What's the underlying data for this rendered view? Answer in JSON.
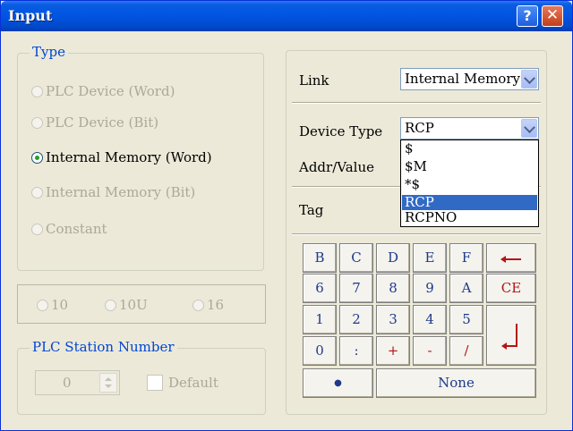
{
  "window": {
    "title": "Input",
    "help_glyph": "?",
    "close_glyph": "✕"
  },
  "type_group": {
    "legend": "Type",
    "options": [
      {
        "label": "PLC Device (Word)",
        "selected": false,
        "enabled": false
      },
      {
        "label": "PLC Device (Bit)",
        "selected": false,
        "enabled": false
      },
      {
        "label": "Internal Memory (Word)",
        "selected": true,
        "enabled": true
      },
      {
        "label": "Internal Memory (Bit)",
        "selected": false,
        "enabled": false
      },
      {
        "label": "Constant",
        "selected": false,
        "enabled": false
      }
    ]
  },
  "radix_group": {
    "options": [
      "10",
      "10U",
      "16"
    ]
  },
  "station_group": {
    "legend": "PLC Station Number",
    "value": "0",
    "default_label": "Default"
  },
  "right": {
    "link_label": "Link",
    "link_value": "Internal Memory",
    "device_type_label": "Device Type",
    "device_type_value": "RCP",
    "addr_label": "Addr/Value",
    "tag_label": "Tag",
    "dropdown_items": [
      "$",
      "$M",
      "*$",
      "RCP",
      "RCPNO"
    ],
    "dropdown_selected": "RCP"
  },
  "keypad": {
    "row1": [
      "B",
      "C",
      "D",
      "E",
      "F"
    ],
    "row2": [
      "6",
      "7",
      "8",
      "9",
      "A"
    ],
    "row3": [
      "1",
      "2",
      "3",
      "4",
      "5"
    ],
    "row4": [
      "0",
      ":",
      "+",
      "-",
      "/"
    ],
    "backspace": "⟵",
    "ce": "CE",
    "enter": "↲",
    "dot": "●",
    "none": "None"
  },
  "icons": {
    "help": "help-icon",
    "close": "close-icon",
    "backspace": "backspace-arrow-icon",
    "enter": "enter-arrow-icon"
  }
}
